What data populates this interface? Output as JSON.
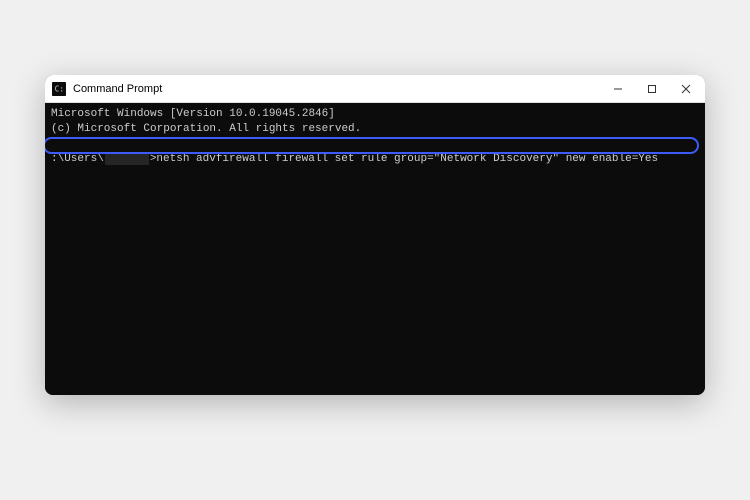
{
  "titlebar": {
    "title": "Command Prompt"
  },
  "terminal": {
    "line1": "Microsoft Windows [Version 10.0.19045.2846]",
    "line2": "(c) Microsoft Corporation. All rights reserved.",
    "prompt_prefix": ":\\Users\\",
    "prompt_suffix": ">",
    "command": "netsh advfirewall firewall set rule group=\"Network Discovery\" new enable=Yes"
  }
}
